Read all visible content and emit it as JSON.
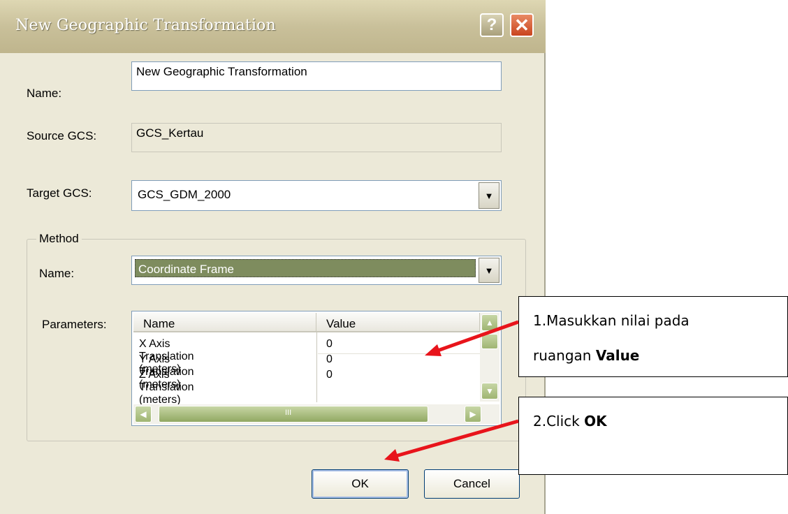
{
  "window": {
    "title": "New Geographic Transformation",
    "help": "?",
    "close": "✕"
  },
  "name_label": "Name:",
  "name_value": "New Geographic Transformation",
  "source_label": "Source GCS:",
  "source_value": "GCS_Kertau",
  "target_label": "Target GCS:",
  "target_value": "GCS_GDM_2000",
  "method": {
    "group_title": "Method",
    "name_label": "Name:",
    "name_value": "Coordinate Frame",
    "params_label": "Parameters:",
    "columns": [
      "Name",
      "Value"
    ],
    "rows": [
      {
        "name": "X Axis Translation (meters)",
        "value": "0"
      },
      {
        "name": "Y Axis Translation (meters)",
        "value": "0"
      },
      {
        "name": "Z Axis Translation (meters)",
        "value": "0"
      }
    ],
    "hscroll_grip": "III"
  },
  "buttons": {
    "ok": "OK",
    "cancel": "Cancel"
  },
  "callouts": {
    "one_line1": "1.Masukkan nilai pada",
    "one_line2_prefix": "ruangan ",
    "one_line2_bold": "Value",
    "two_prefix": "2.Click ",
    "two_bold": "OK"
  },
  "colors": {
    "arrow": "#e8141b",
    "selection": "#7e8c5e"
  }
}
